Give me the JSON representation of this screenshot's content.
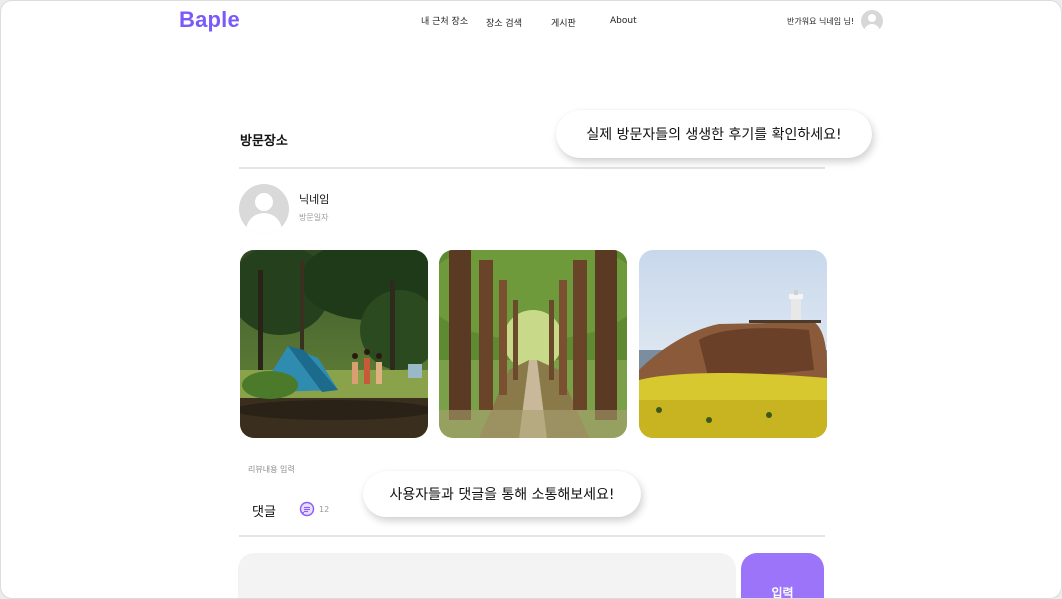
{
  "header": {
    "logo": "Baple",
    "nav": [
      "내 근처 장소",
      "장소 검색",
      "게시판",
      "About"
    ],
    "greeting": "반가워요 닉네임 님!"
  },
  "section": {
    "title": "방문장소"
  },
  "post": {
    "nickname": "닉네임",
    "visit_date_label": "방문일자",
    "photos": [
      "camping-tent-forest",
      "tree-lined-forest-path",
      "coastal-hill-lighthouse-flowers"
    ]
  },
  "review": {
    "placeholder": "리뷰내용 입력"
  },
  "comments": {
    "label": "댓글",
    "icon": "chat-bubble-icon",
    "count": "12"
  },
  "input": {
    "submit_label": "입력"
  },
  "callouts": {
    "reviews": "실제 방문자들의 생생한 후기를 확인하세요!",
    "comments": "사용자들과 댓글을 통해 소통해보세요!"
  },
  "colors": {
    "brand": "#7a5af8",
    "button": "#9b74f9",
    "divider": "#e4e4e4"
  }
}
